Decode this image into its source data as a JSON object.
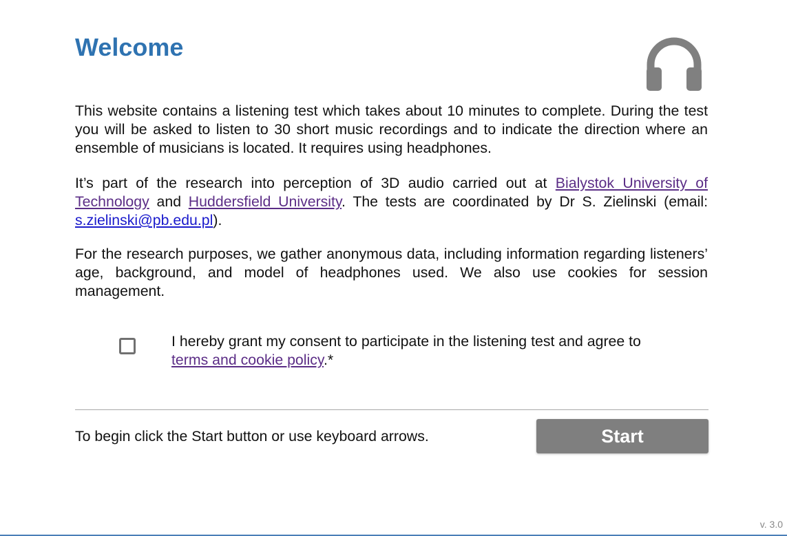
{
  "header": {
    "title": "Welcome",
    "icon": "headphones-icon",
    "title_color": "#2f73b1"
  },
  "intro": {
    "paragraph1": "This website contains a listening test which takes about 10 minutes to complete. During the test you will be asked to listen to 30 short music recordings and to indicate the direction where an ensemble of musicians is located. It requires using headphones.",
    "paragraph2": {
      "text_before": "It’s part of the research into perception of 3D audio carried out at ",
      "link1": "Bialystok University of Technology",
      "text_between": " and ",
      "link2": "Huddersfield University",
      "text_after": ". The tests are coordinated by Dr S. Zielinski (email: ",
      "email": "s.zielinski@pb.edu.pl",
      "text_end": ")."
    },
    "paragraph3": "For the research purposes, we gather anonymous data, including information regarding listeners’ age, background, and model of headphones used. We also use cookies for session management."
  },
  "consent": {
    "checked": false,
    "text_before": "I hereby grant my consent to participate in the listening test and agree to ",
    "link": "terms and cookie policy",
    "text_after": ".*"
  },
  "footer": {
    "hint": "To begin click the Start button or use keyboard arrows.",
    "start_label": "Start",
    "start_color": "#7f7f7f"
  },
  "version": "v. 3.0"
}
